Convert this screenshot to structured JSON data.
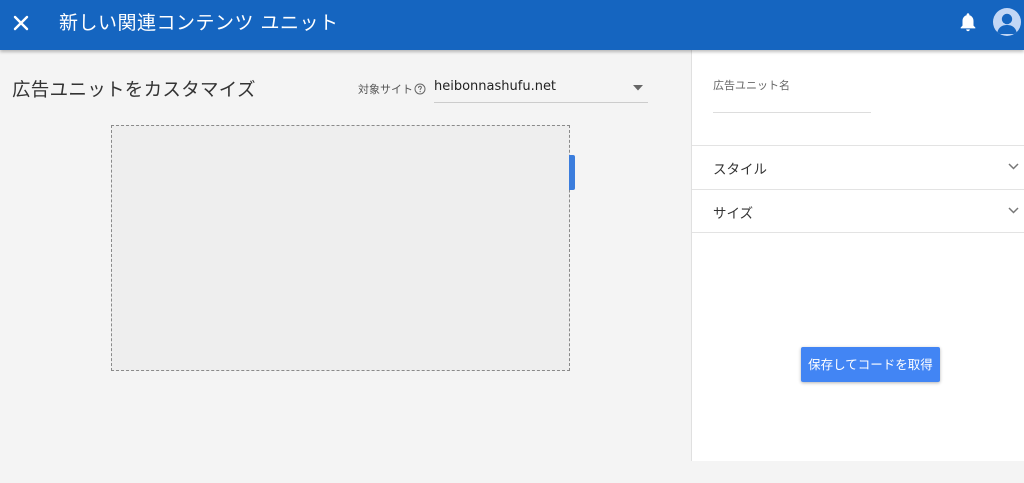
{
  "header": {
    "title": "新しい関連コンテンツ ユニット",
    "background": "#1565c0"
  },
  "main": {
    "heading": "広告ユニットをカスタマイズ",
    "target_site_label": "対象サイト",
    "target_site_value": "heibonnashufu.net"
  },
  "panel": {
    "name_label": "広告ユニット名",
    "name_value": "",
    "accordions": [
      {
        "label": "スタイル"
      },
      {
        "label": "サイズ"
      }
    ],
    "save_button_label": "保存してコードを取得",
    "accent_color": "#4285f4"
  },
  "icons": {
    "close": "close-icon",
    "bell": "bell-icon",
    "avatar": "account-icon",
    "help": "help-circle-icon",
    "dropdown": "triangle-down-icon",
    "chevron": "chevron-down-icon"
  }
}
